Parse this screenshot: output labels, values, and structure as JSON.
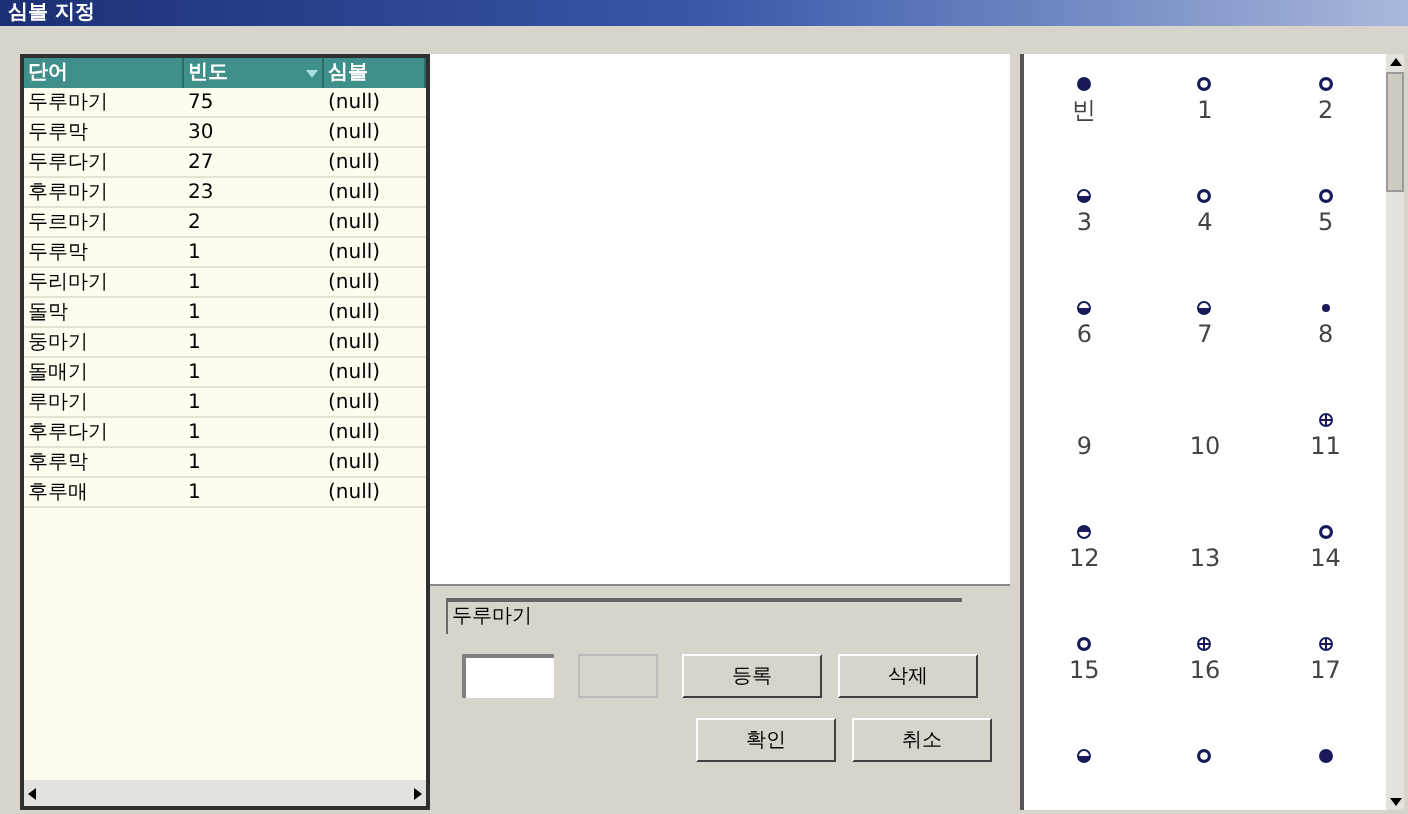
{
  "window": {
    "title": "심볼 지정"
  },
  "table": {
    "columns": [
      {
        "label": "단어",
        "sorted": false
      },
      {
        "label": "빈도",
        "sorted": true
      },
      {
        "label": "심볼",
        "sorted": false
      }
    ],
    "rows": [
      {
        "word": "두루마기",
        "freq": "75",
        "symbol": "(null)"
      },
      {
        "word": "두루막",
        "freq": "30",
        "symbol": "(null)"
      },
      {
        "word": "두루다기",
        "freq": "27",
        "symbol": "(null)"
      },
      {
        "word": "후루마기",
        "freq": "23",
        "symbol": "(null)"
      },
      {
        "word": "두르마기",
        "freq": "2",
        "symbol": "(null)"
      },
      {
        "word": "두루막",
        "freq": "1",
        "symbol": "(null)"
      },
      {
        "word": "두리마기",
        "freq": "1",
        "symbol": "(null)"
      },
      {
        "word": "돌막",
        "freq": "1",
        "symbol": "(null)"
      },
      {
        "word": "둥마기",
        "freq": "1",
        "symbol": "(null)"
      },
      {
        "word": "돌매기",
        "freq": "1",
        "symbol": "(null)"
      },
      {
        "word": "루마기",
        "freq": "1",
        "symbol": "(null)"
      },
      {
        "word": "후루다기",
        "freq": "1",
        "symbol": "(null)"
      },
      {
        "word": "후루막",
        "freq": "1",
        "symbol": "(null)"
      },
      {
        "word": "후루매",
        "freq": "1",
        "symbol": "(null)"
      }
    ]
  },
  "editor": {
    "word_field": {
      "value": "두루마기"
    },
    "buttons": [
      {
        "label": "등록"
      },
      {
        "label": "삭제"
      },
      {
        "label": "확인"
      },
      {
        "label": "취소"
      }
    ]
  },
  "symbols": [
    {
      "label": "빈",
      "kind": "filled"
    },
    {
      "label": "1",
      "kind": "ring"
    },
    {
      "label": "2",
      "kind": "ring"
    },
    {
      "label": "3",
      "kind": "bottom"
    },
    {
      "label": "4",
      "kind": "ring"
    },
    {
      "label": "5",
      "kind": "ring"
    },
    {
      "label": "6",
      "kind": "bottom"
    },
    {
      "label": "7",
      "kind": "bottom"
    },
    {
      "label": "8",
      "kind": "small"
    },
    {
      "label": "9",
      "kind": "none"
    },
    {
      "label": "10",
      "kind": "none"
    },
    {
      "label": "11",
      "kind": "cross"
    },
    {
      "label": "12",
      "kind": "top"
    },
    {
      "label": "13",
      "kind": "none"
    },
    {
      "label": "14",
      "kind": "ring"
    },
    {
      "label": "15",
      "kind": "ring"
    },
    {
      "label": "16",
      "kind": "cross"
    },
    {
      "label": "17",
      "kind": "cross"
    },
    {
      "kind": "bottom"
    },
    {
      "kind": "ring"
    },
    {
      "kind": "filled"
    }
  ]
}
